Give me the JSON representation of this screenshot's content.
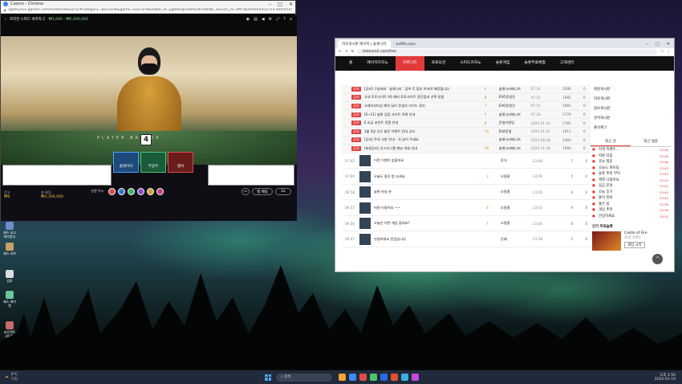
{
  "desktop": {
    "icons": [
      {
        "label": "제스 요고\n에가원고"
      },
      {
        "label": "제스\n라흐"
      },
      {
        "label": "압호"
      },
      {
        "label": "제스\n에가엔"
      },
      {
        "label": "프로젝트\n2025-01-1"
      },
      {
        "label": "5555"
      }
    ]
  },
  "left_window": {
    "title": "Casino - Chrome",
    "url": "agmtyevo-games.com/frontend/evo/r2/#category=baccarat&game=baccarat&table_id=pgdk6rlpnk6fssl4o5bfdbi_launch_id=0ffc5ba0004445a75a-4bd5f5e5bd22...",
    "stream_title": "코리안 스피드 바카라 C",
    "stream_limit": "₩1,000 - ₩5,000,000",
    "table_banner": "PLAYER   BANKER",
    "score_card": "4",
    "balance_label": "잔고",
    "balance_value": "₩0",
    "total_bet_label": "총 베팅",
    "total_bet_value": "₩3,300,000",
    "bet_player": "플레이어",
    "bet_tie": "무승부",
    "bet_banker": "뱅커",
    "controls": {
      "undo": "실행 취소",
      "side_bet": "행 베팅",
      "repeat": "2x"
    },
    "chip_colors": [
      "#d84c4c",
      "#3a78c9",
      "#3bb36a",
      "#8a4cc9",
      "#c9a23a",
      "#cc3a8a"
    ]
  },
  "right_window": {
    "tabs": [
      {
        "label": "자유게시판 메이저 | 슬롯나라",
        "active": true
      },
      {
        "label": "tu99h.com",
        "active": false
      }
    ],
    "url": "slotnara2.com/free",
    "nav": [
      "홈",
      "메이저카지노",
      "커뮤니티",
      "프로모션",
      "스피드카지노",
      "슬롯게임",
      "슬롯무료체험",
      "고객센터"
    ],
    "nav_active": 2,
    "notices": [
      {
        "badge": "공지",
        "title": "[공지] 구글에서 ' 슬롯나라 ' 검색 후 접속 하셔야 해킹됩니다",
        "cnt": "4",
        "author": "슬롯나라매니저",
        "date": "07.14",
        "v1": "2006",
        "v2": "0"
      },
      {
        "badge": "공지",
        "title": "국내 토토사이트 VS 해외 토토사이트 장단점과 선택 방법",
        "cnt": "8",
        "author": "EVO운영진",
        "date": "07.15",
        "v1": "1992",
        "v2": "0"
      },
      {
        "badge": "공지",
        "title": "크레이지타임 해외 딜러 운영사 가이드 정리",
        "cnt": "7",
        "author": "EVO운영진",
        "date": "07.15",
        "v1": "1981",
        "v2": "0"
      },
      {
        "badge": "공지",
        "title": "[0~11] 슬롯 검증 사이트 목록 안내",
        "cnt": "5",
        "author": "슬롯나라매니저",
        "date": "07.18",
        "v1": "1770",
        "v2": "0"
      },
      {
        "badge": "공지",
        "title": "E 요금 포인트 전환 안내",
        "cnt": "6",
        "author": "운영지원팀",
        "date": "2025.01.15",
        "v1": "1781",
        "v2": "0"
      },
      {
        "badge": "공지",
        "title": "1월 3일 신규 충전 이벤트 안내 공지",
        "cnt": "10",
        "author": "EVA운영",
        "date": "2025.01.03",
        "v1": "1611",
        "v2": "0"
      },
      {
        "badge": "공지",
        "title": "[공지] 주의 사항 안내 - 꼭 읽어 주세요",
        "cnt": "",
        "author": "슬롯나라매니저",
        "date": "2023.08.28",
        "v1": "2460",
        "v2": "0"
      },
      {
        "badge": "공지",
        "title": "[회원공지] 인스타그램 채널 개설 안내",
        "cnt": "16",
        "author": "슬롯나라매니저",
        "date": "2023.11.28",
        "v1": "1560",
        "v2": "0"
      }
    ],
    "posts": [
      {
        "time": "07:02",
        "title": "이런 이벤트 없을까요",
        "cnt": "",
        "author": "준식",
        "date": "23:48",
        "v1": "7",
        "v2": "0"
      },
      {
        "time": "07:00",
        "title": "오늘도 좋은 밤 되세요",
        "cnt": "3",
        "author": "오용환",
        "date": "23:46",
        "v1": "5",
        "v2": "0"
      },
      {
        "time": "06:58",
        "title": "슬롯 하실 분",
        "cnt": "",
        "author": "오용환",
        "date": "23:45",
        "v1": "4",
        "v2": "0"
      },
      {
        "time": "06:55",
        "title": "빅윈 터졌어요 ~~",
        "cnt": "8",
        "author": "오용환",
        "date": "23:42",
        "v1": "9",
        "v2": "0"
      },
      {
        "time": "06:50",
        "title": "오늘은 어떤 게임 할까요?",
        "cnt": "7",
        "author": "오용환",
        "date": "23:40",
        "v1": "6",
        "v2": "0"
      },
      {
        "time": "06:47",
        "title": "안녕하세요 반갑습니다",
        "cnt": "",
        "author": "준혜",
        "date": "23:38",
        "v1": "5",
        "v2": "0"
      }
    ],
    "sidebar_links": [
      "회원게시판",
      "자유게시판",
      "정보게시판",
      "유머게시판",
      "출석체크"
    ],
    "recent_tabs": [
      "최근 글",
      "최근 댓글"
    ],
    "recent": [
      {
        "title": "이게 이벤트...",
        "time": "23:48"
      },
      {
        "title": "빅윈 터짐",
        "time": "23:48"
      },
      {
        "title": "초보 질문",
        "time": "23:46"
      },
      {
        "title": "오늘도 화이팅",
        "time": "23:45"
      },
      {
        "title": "슬롯 추천 부탁",
        "time": "23:45"
      },
      {
        "title": "잭팟 나왔어요",
        "time": "23:43"
      },
      {
        "title": "입금 문의",
        "time": "23:42"
      },
      {
        "title": "오늘 후기",
        "time": "23:40"
      },
      {
        "title": "출석 완료",
        "time": "23:40"
      },
      {
        "title": "좋은 밤",
        "time": "23:38"
      },
      {
        "title": "게임 추천",
        "time": "23:36"
      },
      {
        "title": "안녕하세요",
        "time": "23:35"
      }
    ],
    "promo_heading": "인기 무료슬롯",
    "promo_game": "Castle of Fire",
    "promo_provider": "프라그마틱",
    "promo_button": "게임 시작"
  },
  "taskbar": {
    "weather_temp": "3°C",
    "weather_desc": "흐림",
    "search_placeholder": "검색",
    "time": "오후 4:56",
    "date": "2025-01-19",
    "app_colors": [
      "#f2a33a",
      "#3a8bf2",
      "#e34a4a",
      "#4ac76a",
      "#2b6ae0",
      "#e0532b",
      "#3ab0e0",
      "#c64ae0"
    ]
  }
}
